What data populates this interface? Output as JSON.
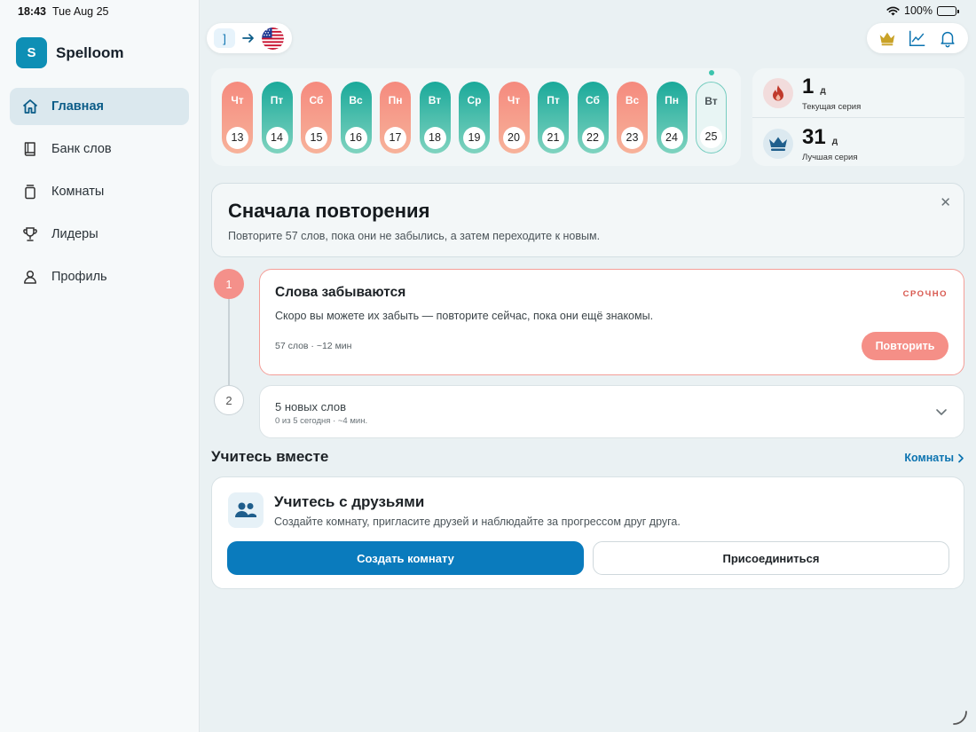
{
  "statusbar": {
    "time": "18:43",
    "date": "Tue Aug 25",
    "battery": "100%"
  },
  "app": {
    "logo_letter": "S",
    "name": "Spelloom"
  },
  "nav": [
    {
      "label": "Главная",
      "icon": "home-icon",
      "active": true
    },
    {
      "label": "Банк слов",
      "icon": "book-icon",
      "active": false
    },
    {
      "label": "Комнаты",
      "icon": "rooms-icon",
      "active": false
    },
    {
      "label": "Лидеры",
      "icon": "trophy-icon",
      "active": false
    },
    {
      "label": "Профиль",
      "icon": "person-icon",
      "active": false
    }
  ],
  "language": {
    "from": "]",
    "to_icon": "us-flag-icon"
  },
  "toolbar": {
    "icons": [
      "crown-icon",
      "chart-icon",
      "bell-icon"
    ],
    "accent": "#c9a227"
  },
  "calendar": [
    {
      "dow": "Чт",
      "day": "13",
      "status": "miss"
    },
    {
      "dow": "Пт",
      "day": "14",
      "status": "done"
    },
    {
      "dow": "Сб",
      "day": "15",
      "status": "miss"
    },
    {
      "dow": "Вс",
      "day": "16",
      "status": "done"
    },
    {
      "dow": "Пн",
      "day": "17",
      "status": "miss"
    },
    {
      "dow": "Вт",
      "day": "18",
      "status": "done"
    },
    {
      "dow": "Ср",
      "day": "19",
      "status": "done"
    },
    {
      "dow": "Чт",
      "day": "20",
      "status": "miss"
    },
    {
      "dow": "Пт",
      "day": "21",
      "status": "done"
    },
    {
      "dow": "Сб",
      "day": "22",
      "status": "done"
    },
    {
      "dow": "Вс",
      "day": "23",
      "status": "miss"
    },
    {
      "dow": "Пн",
      "day": "24",
      "status": "done"
    },
    {
      "dow": "Вт",
      "day": "25",
      "status": "today"
    }
  ],
  "streaks": {
    "current": {
      "value": "1",
      "unit": "д",
      "label": "Текущая серия"
    },
    "best": {
      "value": "31",
      "unit": "д",
      "label": "Лучшая серия"
    }
  },
  "hero": {
    "title": "Сначала повторения",
    "subtitle": "Повторите 57 слов, пока они не забылись, а затем переходите к новым."
  },
  "steps": {
    "one": {
      "number": "1",
      "title": "Слова забываются",
      "badge": "СРОЧНО",
      "description": "Скоро вы можете их забыть — повторите сейчас, пока они ещё знакомы.",
      "meta": "57 слов · ~12 мин",
      "button": "Повторить"
    },
    "two": {
      "number": "2",
      "title": "5 новых слов",
      "meta": "0 из 5 сегодня · ~4 мин."
    }
  },
  "together": {
    "heading": "Учитесь вместе",
    "link": "Комнаты",
    "card_title": "Учитесь с друзьями",
    "card_subtitle": "Создайте комнату, пригласите друзей и наблюдайте за прогрессом друг друга.",
    "primary_button": "Создать комнату",
    "secondary_button": "Присоединиться"
  },
  "colors": {
    "primary": "#0a7bbd",
    "urgent": "#f58f87",
    "teal": "#1aa99a",
    "coral": "#f58a7e"
  }
}
